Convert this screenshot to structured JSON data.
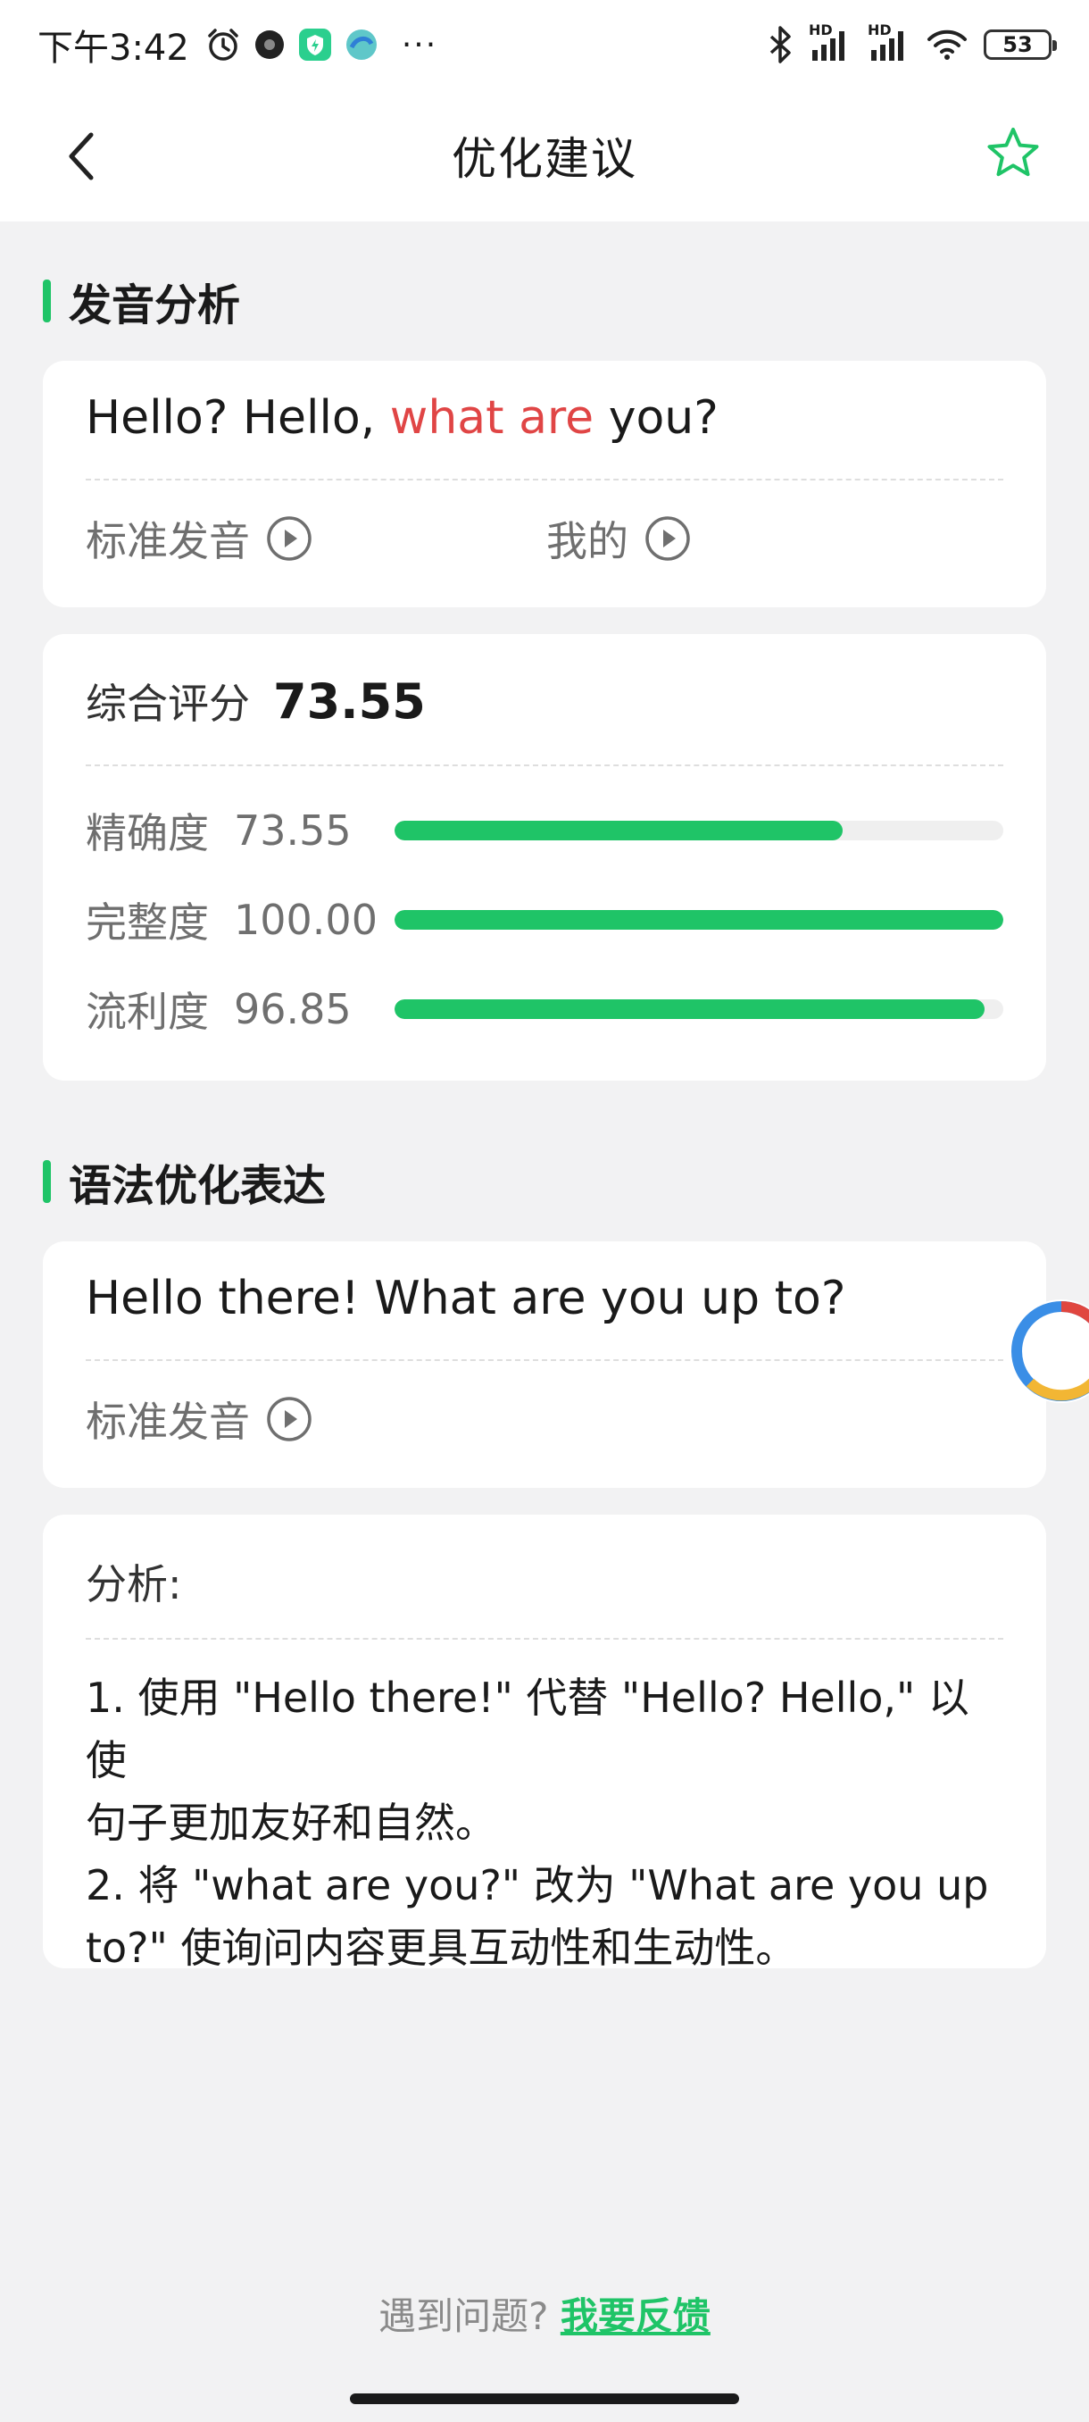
{
  "status_bar": {
    "time": "下午3:42",
    "battery": "53",
    "more": "···",
    "net_label_1": "HD",
    "net_label_2": "HD"
  },
  "header": {
    "title": "优化建议"
  },
  "pronunciation_section": {
    "title": "发音分析",
    "sentence_before": "Hello? Hello, ",
    "sentence_highlight": "what are",
    "sentence_after": " you?",
    "standard_label": "标准发音",
    "mine_label": "我的"
  },
  "score_card": {
    "overall_label": "综合评分",
    "overall_value": "73.55",
    "metrics": [
      {
        "label": "精确度",
        "value": "73.55",
        "fill": 0.7355
      },
      {
        "label": "完整度",
        "value": "100.00",
        "fill": 1.0
      },
      {
        "label": "流利度",
        "value": "96.85",
        "fill": 0.9685
      }
    ]
  },
  "grammar_section": {
    "title": "语法优化表达",
    "sentence": "Hello there! What are you up to?",
    "standard_label": "标准发音"
  },
  "analysis_card": {
    "label": "分析:",
    "text": "1. 使用 \"Hello there!\" 代替 \"Hello? Hello,\" 以使\n句子更加友好和自然。\n2. 将 \"what are you?\" 改为 \"What are you up\nto?\" 使询问内容更具互动性和生动性。"
  },
  "footer": {
    "question": "遇到问题?",
    "feedback_link": "我要反馈"
  },
  "colors": {
    "accent": "#1fc467",
    "highlight": "#e04545",
    "background": "#f2f2f3"
  }
}
